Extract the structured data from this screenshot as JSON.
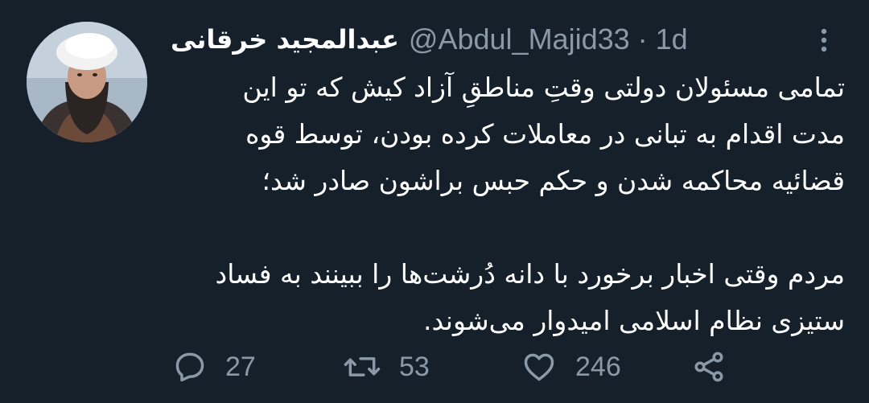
{
  "tweet": {
    "display_name": "عبدالمجید خرقانی",
    "handle": "@Abdul_Majid33",
    "separator": "·",
    "time": "1d",
    "body_lines": [
      "تمامی مسئولان دولتی وقتِ مناطقِ آزاد کیش که تو این",
      "مدت  اقدام به تبانی در معاملات کرده بودن، توسط قوه",
      "قضائیه محاکمه شدن و حکم حبس براشون صادر شد؛",
      "",
      "مردم وقتی اخبار برخورد با دانه دُرشت‌ها را ببینند به فساد",
      "ستیزی نظام اسلامی امیدوار می‌شوند."
    ]
  },
  "actions": {
    "reply": {
      "icon": "reply-icon",
      "count": "27"
    },
    "retweet": {
      "icon": "retweet-icon",
      "count": "53"
    },
    "like": {
      "icon": "heart-icon",
      "count": "246"
    },
    "share": {
      "icon": "share-icon"
    }
  },
  "colors": {
    "background": "#15202b",
    "text_primary": "#ffffff",
    "text_secondary": "#8b98a5"
  }
}
